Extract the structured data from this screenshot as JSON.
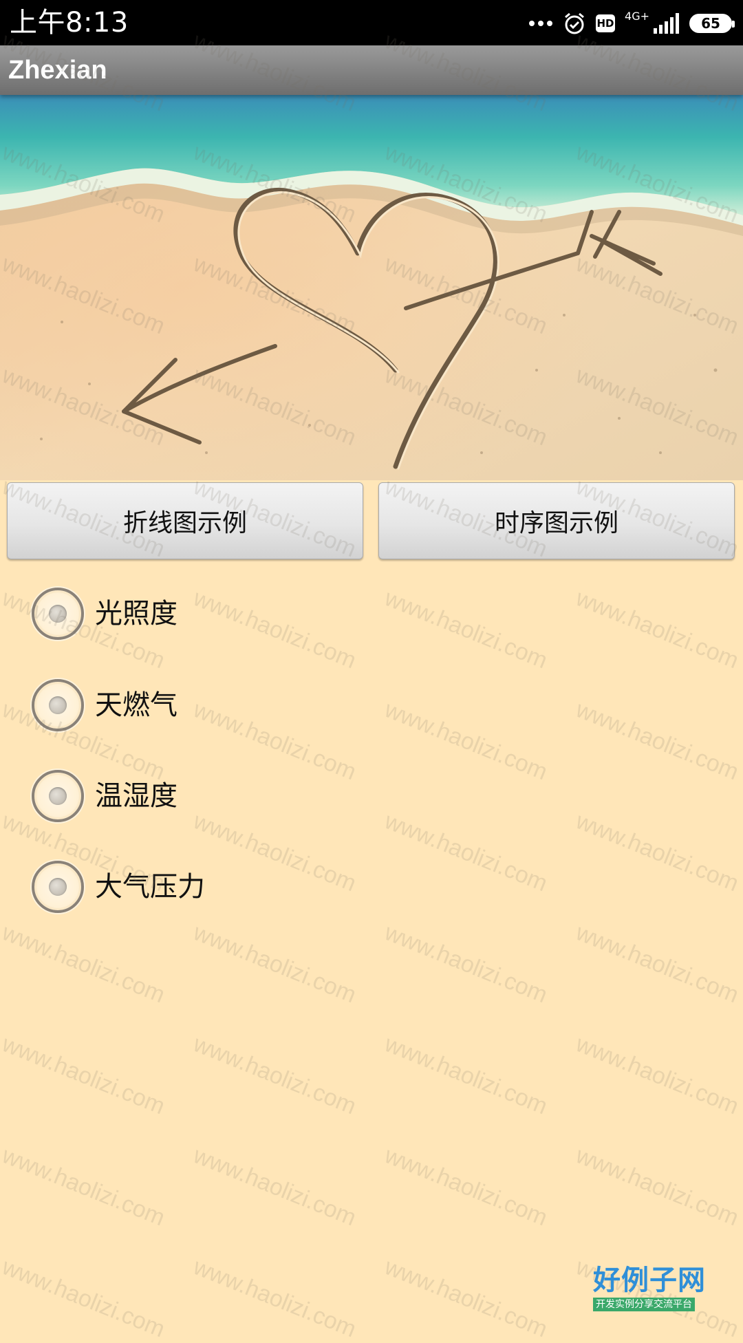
{
  "status_bar": {
    "time": "上午8:13",
    "network": "4G+",
    "hd": "HD",
    "battery": "65"
  },
  "app_bar": {
    "title": "Zhexian"
  },
  "buttons": {
    "line_chart": "折线图示例",
    "time_series": "时序图示例"
  },
  "options": [
    {
      "label": "光照度",
      "checked": false
    },
    {
      "label": "天燃气",
      "checked": false
    },
    {
      "label": "温湿度",
      "checked": false
    },
    {
      "label": "大气压力",
      "checked": false
    }
  ],
  "watermark": "www.haolizi.com",
  "logo": {
    "main": "好例子网",
    "sub": "开发实例分享交流平台"
  }
}
